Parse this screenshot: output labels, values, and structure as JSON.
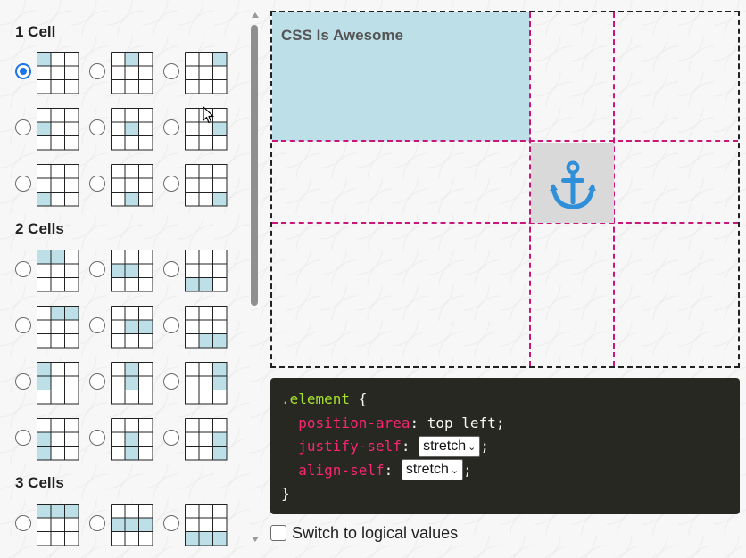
{
  "left_panel": {
    "groups": [
      {
        "title": "1 Cell",
        "options": [
          {
            "cells": [
              [
                0,
                1
              ]
            ],
            "checked": true
          },
          {
            "cells": [
              [
                1,
                2
              ]
            ],
            "checked": false
          },
          {
            "cells": [
              [
                2,
                3
              ]
            ],
            "checked": false
          },
          {
            "cells": [
              [
                4,
                5
              ]
            ],
            "checked": false
          },
          {
            "cells": [
              [
                5,
                6
              ]
            ],
            "checked": false
          },
          {
            "cells": [
              [
                6,
                7
              ]
            ],
            "checked": false
          },
          {
            "cells": [
              [
                8,
                9
              ]
            ],
            "checked": false
          },
          {
            "cells": [
              [
                9,
                10
              ]
            ],
            "checked": false
          },
          {
            "cells": [
              [
                10,
                11
              ]
            ],
            "checked": false
          }
        ]
      },
      {
        "title": "2 Cells",
        "options": [
          {
            "cells": [
              [
                0,
                2
              ]
            ],
            "checked": false
          },
          {
            "cells": [
              [
                4,
                6
              ]
            ],
            "checked": false
          },
          {
            "cells": [
              [
                8,
                10
              ]
            ],
            "checked": false
          },
          {
            "cells": [
              [
                1,
                3
              ]
            ],
            "checked": false
          },
          {
            "cells": [
              [
                5,
                7
              ]
            ],
            "checked": false
          },
          {
            "cells": [
              [
                9,
                11
              ]
            ],
            "checked": false
          },
          {
            "cells": [
              [
                0,
                1
              ],
              [
                4,
                5
              ]
            ],
            "checked": false
          },
          {
            "cells": [
              [
                1,
                2
              ],
              [
                5,
                6
              ]
            ],
            "checked": false
          },
          {
            "cells": [
              [
                2,
                3
              ],
              [
                6,
                7
              ]
            ],
            "checked": false
          },
          {
            "cells": [
              [
                4,
                5
              ],
              [
                8,
                9
              ]
            ],
            "checked": false
          },
          {
            "cells": [
              [
                5,
                6
              ],
              [
                9,
                10
              ]
            ],
            "checked": false
          },
          {
            "cells": [
              [
                6,
                7
              ],
              [
                10,
                11
              ]
            ],
            "checked": false
          }
        ]
      },
      {
        "title": "3 Cells",
        "options": [
          {
            "cells": [
              [
                0,
                3
              ]
            ],
            "checked": false
          },
          {
            "cells": [
              [
                4,
                7
              ]
            ],
            "checked": false
          },
          {
            "cells": [
              [
                8,
                11
              ]
            ],
            "checked": false
          }
        ]
      }
    ]
  },
  "preview": {
    "element_label": "CSS Is Awesome",
    "anchor_icon": "anchor-icon",
    "colors": {
      "element_bg": "#bde0e8",
      "anchor_cell_bg": "#d9d9d9",
      "grid_lines": "#c8167a"
    }
  },
  "code": {
    "selector": ".element",
    "open_brace": " {",
    "close_brace": "}",
    "position_area": {
      "prop": "position-area",
      "value": "top left"
    },
    "justify_self": {
      "prop": "justify-self",
      "value": "stretch"
    },
    "align_self": {
      "prop": "align-self",
      "value": "stretch"
    }
  },
  "logical_toggle": {
    "label": "Switch to logical values",
    "checked": false
  }
}
